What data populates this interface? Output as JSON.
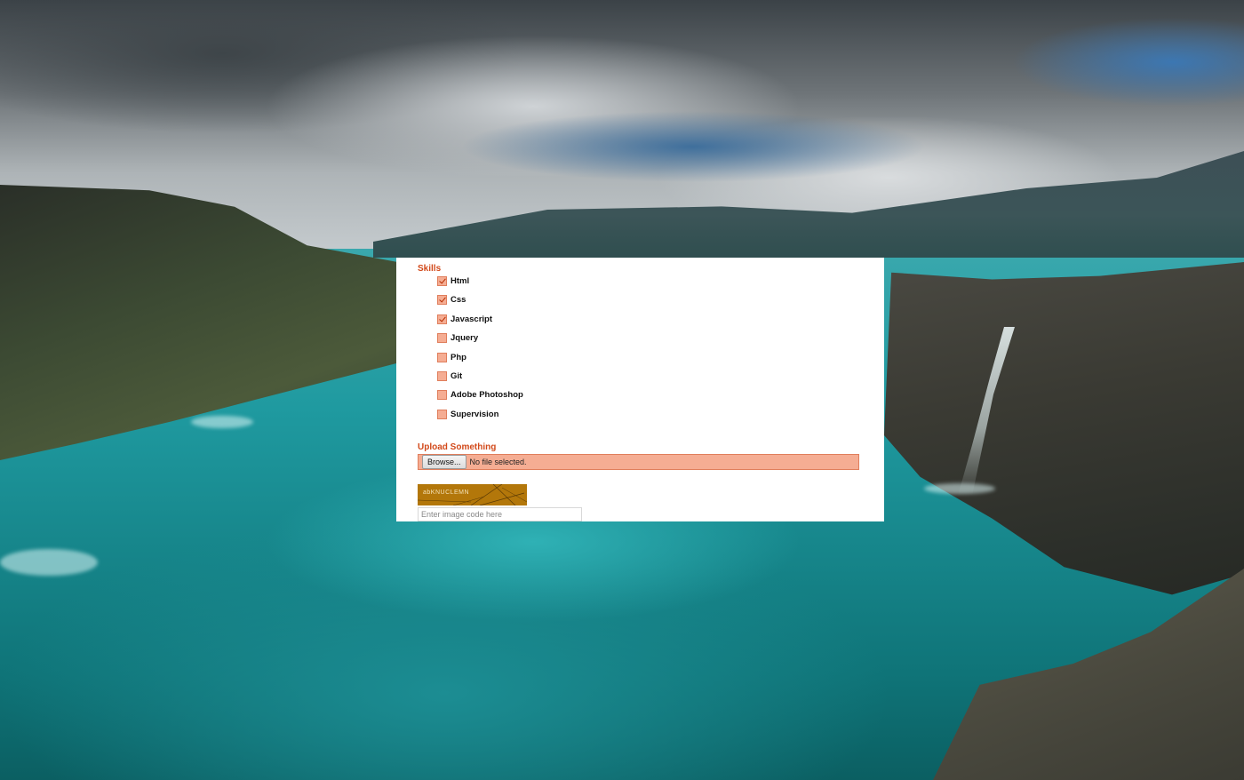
{
  "form": {
    "skills": {
      "label": "Skills",
      "items": [
        {
          "label": "Html",
          "checked": true
        },
        {
          "label": "Css",
          "checked": true
        },
        {
          "label": "Javascript",
          "checked": true
        },
        {
          "label": "Jquery",
          "checked": false
        },
        {
          "label": "Php",
          "checked": false
        },
        {
          "label": "Git",
          "checked": false
        },
        {
          "label": "Adobe Photoshop",
          "checked": false
        },
        {
          "label": "Supervision",
          "checked": false
        }
      ]
    },
    "upload": {
      "label": "Upload Something",
      "browse_label": "Browse...",
      "status": "No file selected."
    },
    "captcha": {
      "image_text": "abKNUCLEMN",
      "input_value": "",
      "input_placeholder": "Enter image code here"
    }
  },
  "colors": {
    "accent": "#d2491a",
    "field_fill": "#f5ad93",
    "field_border": "#e07e5c",
    "captcha_bg": "#b3770a"
  }
}
